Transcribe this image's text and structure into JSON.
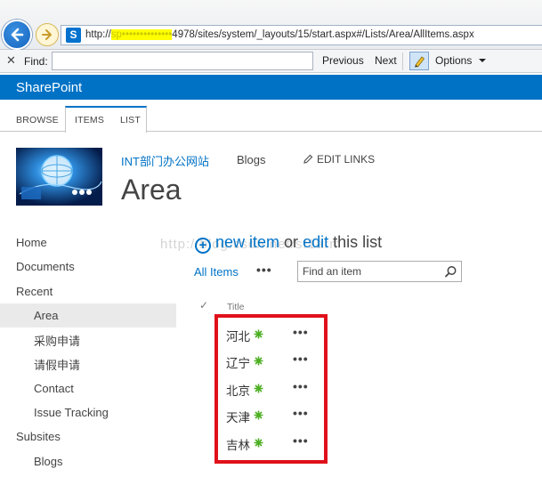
{
  "browser": {
    "url_host": "sp••••••••••••••",
    "url_rest": "4978/sites/system/_layouts/15/start.aspx#/Lists/Area/AllItems.aspx",
    "url_prefix": "http://"
  },
  "findbar": {
    "label": "Find:",
    "value": "",
    "previous": "Previous",
    "next": "Next",
    "options": "Options"
  },
  "suite": {
    "brand": "SharePoint"
  },
  "ribbon": {
    "tabs": [
      "BROWSE",
      "ITEMS",
      "LIST"
    ]
  },
  "site": {
    "title_link": "INT部门办公网站",
    "blogs": "Blogs",
    "edit_links": "EDIT LINKS",
    "page_title": "Area"
  },
  "nav": {
    "items": [
      {
        "label": "Home"
      },
      {
        "label": "Documents"
      },
      {
        "label": "Recent"
      },
      {
        "label": "Area"
      },
      {
        "label": "采购申请"
      },
      {
        "label": "请假申请"
      },
      {
        "label": "Contact"
      },
      {
        "label": "Issue Tracking"
      },
      {
        "label": "Subsites"
      },
      {
        "label": "Blogs"
      }
    ]
  },
  "watermark": "http://blog.csdn.net/sf1arm",
  "list": {
    "new_item_link": "new item",
    "or_text": "or",
    "edit_link": "edit",
    "this_list": "this list",
    "view_name": "All Items",
    "view_menu": "•••",
    "search_placeholder": "Find an item",
    "column_title": "Title",
    "check_mark": "✓",
    "rows": [
      {
        "title": "河北",
        "menu": "•••"
      },
      {
        "title": "辽宁",
        "menu": "•••"
      },
      {
        "title": "北京",
        "menu": "•••"
      },
      {
        "title": "天津",
        "menu": "•••"
      },
      {
        "title": "吉林",
        "menu": "•••"
      }
    ]
  },
  "colors": {
    "sharepoint_blue": "#0072c6",
    "annotation_red": "#e0101a",
    "new_badge_green": "#4caf22"
  }
}
